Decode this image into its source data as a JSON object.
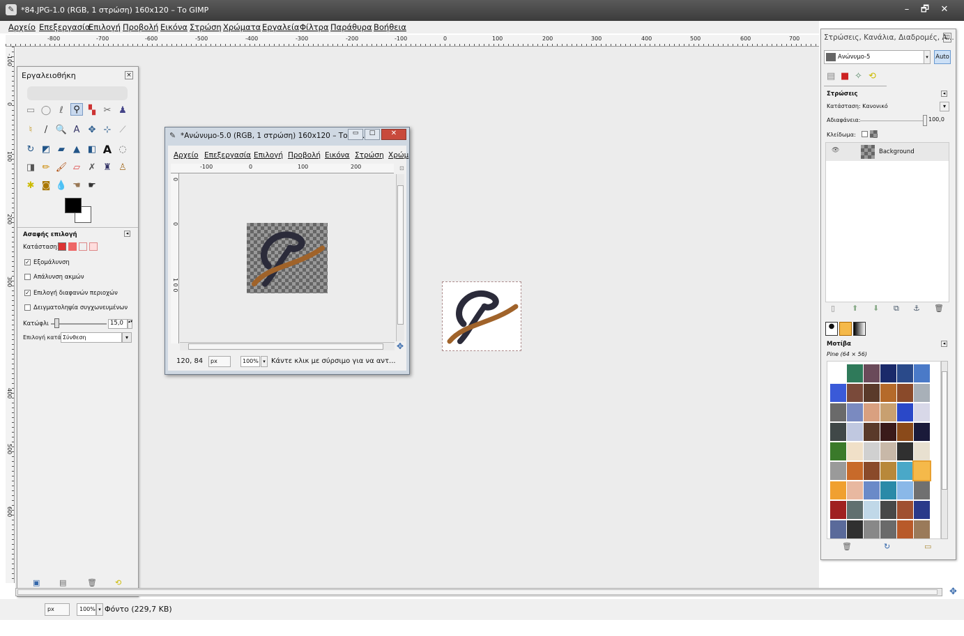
{
  "window": {
    "title": "*84.JPG-1.0 (RGB, 1 στρώση) 160x120 – Το GIMP",
    "minimize": "–",
    "restore": "🗗",
    "close": "✕"
  },
  "menu": [
    "Αρχείο",
    "Επεξεργασία",
    "Επιλογή",
    "Προβολή",
    "Εικόνα",
    "Στρώση",
    "Χρώματα",
    "Εργαλεία",
    "Φίλτρα",
    "Παράθυρα",
    "Βοήθεια"
  ],
  "hruler": [
    "-800",
    "-700",
    "-600",
    "-500",
    "-400",
    "-300",
    "-200",
    "-100",
    "0",
    "100",
    "200",
    "300",
    "400",
    "500",
    "600",
    "700"
  ],
  "vruler": [
    "-100",
    "0",
    "100",
    "200",
    "300",
    "400",
    "500",
    "600"
  ],
  "toolbox": {
    "title": "Εργαλειοθήκη",
    "tool_options_title": "Ασαφής επιλογή",
    "mode_label": "Κατάσταση:",
    "antialias": "Εξομάλυνση",
    "feather": "Απάλυνση ακμών",
    "select_transparent": "Επιλογή διαφανών περιοχών",
    "sample_merged": "Δειγματοληψία συγχωνευμένων",
    "threshold_label": "Κατώφλι",
    "threshold_value": "15,0",
    "select_by_label": "Επιλογή κατά:",
    "select_by_value": "Σύνθεση",
    "threshold_fraction": 0.06
  },
  "image_window": {
    "title": "*Ανώνυμο-5.0 (RGB, 1 στρώση) 160x120 – Το GI...",
    "menu": [
      "Αρχείο",
      "Επεξεργασία",
      "Επιλογή",
      "Προβολή",
      "Εικόνα",
      "Στρώση",
      "Χρώμ"
    ],
    "ruler": [
      "-100",
      "0",
      "100",
      "200"
    ],
    "vruler": [
      "0",
      "0",
      "1\n0\n0"
    ],
    "coords": "120, 84",
    "unit": "px",
    "zoom": "100%",
    "status": "Κάντε κλικ με σύρσιμο για να αντ..."
  },
  "dock": {
    "title": "Στρώσεις, Κανάλια, Διαδρομές, Α...",
    "image_select": "Ανώνυμο-5",
    "auto_button": "Auto",
    "layers_title": "Στρώσεις",
    "mode_label": "Κατάσταση:",
    "mode_value": "Κανονικό",
    "opacity_label": "Αδιαφάνεια:",
    "opacity_value": "100,0",
    "lock_label": "Κλείδωμα:",
    "layer_name": "Background",
    "patterns_title": "Μοτίβα",
    "pattern_name": "Pine (64 × 56)"
  },
  "status": {
    "unit": "px",
    "zoom": "100%",
    "info": "Φόντο (229,7 KB)"
  },
  "colors": {
    "titlebar": "#3c3c3c",
    "checker_dark": "#666666",
    "checker_light": "#999999",
    "selected_tool": "#c9d9ee"
  },
  "icons": [
    "wilber-icon",
    "pencil-icon",
    "paintbrush-icon",
    "eraser-icon",
    "fuzzy-select-icon",
    "text-icon",
    "zoom-icon",
    "move-icon",
    "bucket-fill-icon",
    "eye-icon",
    "trash-icon",
    "refresh-icon"
  ]
}
